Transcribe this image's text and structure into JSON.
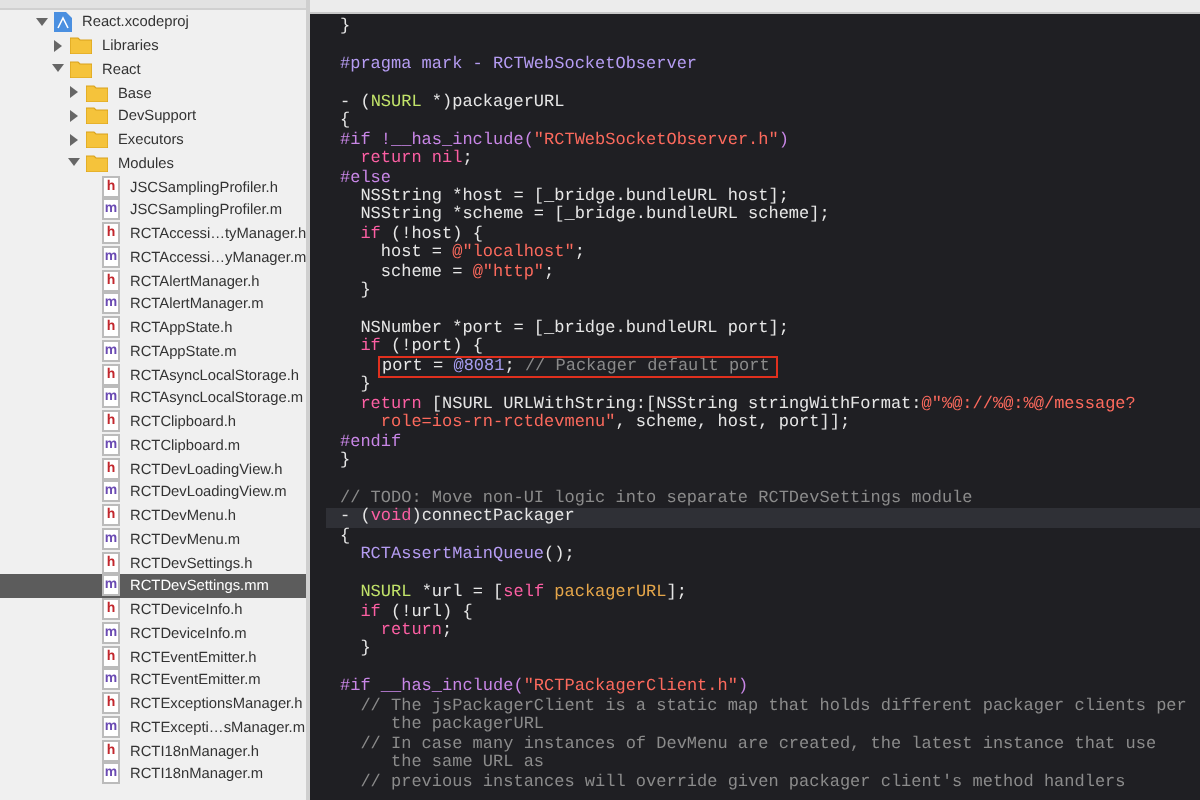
{
  "navigator": {
    "items": [
      {
        "label": "React.xcodeproj",
        "kind": "project",
        "expanded": true,
        "selected": false,
        "children": [
          {
            "label": "Libraries",
            "kind": "folder",
            "expanded": false,
            "selected": false
          },
          {
            "label": "React",
            "kind": "folder",
            "expanded": true,
            "selected": false,
            "children": [
              {
                "label": "Base",
                "kind": "folder",
                "expanded": false,
                "selected": false
              },
              {
                "label": "DevSupport",
                "kind": "folder",
                "expanded": false,
                "selected": false
              },
              {
                "label": "Executors",
                "kind": "folder",
                "expanded": false,
                "selected": false
              },
              {
                "label": "Modules",
                "kind": "folder",
                "expanded": true,
                "selected": false,
                "children": [
                  {
                    "label": "JSCSamplingProfiler.h",
                    "kind": "header",
                    "badge": "h",
                    "selected": false
                  },
                  {
                    "label": "JSCSamplingProfiler.m",
                    "kind": "source",
                    "badge": "m",
                    "selected": false
                  },
                  {
                    "label": "RCTAccessi…tyManager.h",
                    "kind": "header",
                    "badge": "h",
                    "selected": false
                  },
                  {
                    "label": "RCTAccessi…yManager.m",
                    "kind": "source",
                    "badge": "m",
                    "selected": false
                  },
                  {
                    "label": "RCTAlertManager.h",
                    "kind": "header",
                    "badge": "h",
                    "selected": false
                  },
                  {
                    "label": "RCTAlertManager.m",
                    "kind": "source",
                    "badge": "m",
                    "selected": false
                  },
                  {
                    "label": "RCTAppState.h",
                    "kind": "header",
                    "badge": "h",
                    "selected": false
                  },
                  {
                    "label": "RCTAppState.m",
                    "kind": "source",
                    "badge": "m",
                    "selected": false
                  },
                  {
                    "label": "RCTAsyncLocalStorage.h",
                    "kind": "header",
                    "badge": "h",
                    "selected": false
                  },
                  {
                    "label": "RCTAsyncLocalStorage.m",
                    "kind": "source",
                    "badge": "m",
                    "selected": false
                  },
                  {
                    "label": "RCTClipboard.h",
                    "kind": "header",
                    "badge": "h",
                    "selected": false
                  },
                  {
                    "label": "RCTClipboard.m",
                    "kind": "source",
                    "badge": "m",
                    "selected": false
                  },
                  {
                    "label": "RCTDevLoadingView.h",
                    "kind": "header",
                    "badge": "h",
                    "selected": false
                  },
                  {
                    "label": "RCTDevLoadingView.m",
                    "kind": "source",
                    "badge": "m",
                    "selected": false
                  },
                  {
                    "label": "RCTDevMenu.h",
                    "kind": "header",
                    "badge": "h",
                    "selected": false
                  },
                  {
                    "label": "RCTDevMenu.m",
                    "kind": "source",
                    "badge": "m",
                    "selected": false
                  },
                  {
                    "label": "RCTDevSettings.h",
                    "kind": "header",
                    "badge": "h",
                    "selected": false
                  },
                  {
                    "label": "RCTDevSettings.mm",
                    "kind": "source",
                    "badge": "m",
                    "selected": true
                  },
                  {
                    "label": "RCTDeviceInfo.h",
                    "kind": "header",
                    "badge": "h",
                    "selected": false
                  },
                  {
                    "label": "RCTDeviceInfo.m",
                    "kind": "source",
                    "badge": "m",
                    "selected": false
                  },
                  {
                    "label": "RCTEventEmitter.h",
                    "kind": "header",
                    "badge": "h",
                    "selected": false
                  },
                  {
                    "label": "RCTEventEmitter.m",
                    "kind": "source",
                    "badge": "m",
                    "selected": false
                  },
                  {
                    "label": "RCTExceptionsManager.h",
                    "kind": "header",
                    "badge": "h",
                    "selected": false
                  },
                  {
                    "label": "RCTExcepti…sManager.m",
                    "kind": "source",
                    "badge": "m",
                    "selected": false
                  },
                  {
                    "label": "RCTI18nManager.h",
                    "kind": "header",
                    "badge": "h",
                    "selected": false
                  },
                  {
                    "label": "RCTI18nManager.m",
                    "kind": "source",
                    "badge": "m",
                    "selected": false
                  }
                ]
              }
            ]
          }
        ]
      }
    ]
  },
  "editor": {
    "lines": [
      {
        "segs": [
          {
            "kind": "plain",
            "t": "}"
          }
        ]
      },
      {
        "space_before": true,
        "segs": [
          {
            "kind": "mark",
            "t": "#pragma mark - RCTWebSocketObserver"
          }
        ]
      },
      {
        "space_before": true,
        "segs": [
          {
            "kind": "plain",
            "t": "- ("
          },
          {
            "kind": "type",
            "t": "NSURL"
          },
          {
            "kind": "plain",
            "t": " *)packagerURL"
          }
        ]
      },
      {
        "segs": [
          {
            "kind": "plain",
            "t": "{"
          }
        ]
      },
      {
        "segs": [
          {
            "kind": "preproc",
            "t": "#if !__has_include("
          },
          {
            "kind": "string",
            "t": "\"RCTWebSocketObserver.h\""
          },
          {
            "kind": "preproc",
            "t": ")"
          }
        ]
      },
      {
        "segs": [
          {
            "kind": "keyword",
            "t": "  return nil"
          },
          {
            "kind": "plain",
            "t": ";"
          }
        ]
      },
      {
        "segs": [
          {
            "kind": "preproc",
            "t": "#else"
          }
        ]
      },
      {
        "segs": [
          {
            "kind": "plain",
            "t": "  NSString *host = [_bridge.bundleURL host];"
          }
        ]
      },
      {
        "segs": [
          {
            "kind": "plain",
            "t": "  NSString *scheme = [_bridge.bundleURL scheme];"
          }
        ]
      },
      {
        "segs": [
          {
            "kind": "keyword",
            "t": "  if"
          },
          {
            "kind": "plain",
            "t": " (!host) {"
          }
        ]
      },
      {
        "segs": [
          {
            "kind": "plain",
            "t": "    host = "
          },
          {
            "kind": "string",
            "t": "@\"localhost\""
          },
          {
            "kind": "plain",
            "t": ";"
          }
        ]
      },
      {
        "segs": [
          {
            "kind": "plain",
            "t": "    scheme = "
          },
          {
            "kind": "string",
            "t": "@\"http\""
          },
          {
            "kind": "plain",
            "t": ";"
          }
        ]
      },
      {
        "segs": [
          {
            "kind": "plain",
            "t": "  }"
          }
        ]
      },
      {
        "space_before": true,
        "segs": [
          {
            "kind": "plain",
            "t": "  NSNumber *port = [_bridge.bundleURL port];"
          }
        ]
      },
      {
        "segs": [
          {
            "kind": "keyword",
            "t": "  if"
          },
          {
            "kind": "plain",
            "t": " (!port) {"
          }
        ]
      },
      {
        "boxed": true,
        "segs": [
          {
            "kind": "plain",
            "t": "port = "
          },
          {
            "kind": "number",
            "t": "@8081"
          },
          {
            "kind": "plain",
            "t": "; "
          },
          {
            "kind": "comment",
            "t": "// Packager default port"
          }
        ]
      },
      {
        "segs": [
          {
            "kind": "plain",
            "t": "  }"
          }
        ]
      },
      {
        "segs": [
          {
            "kind": "keyword",
            "t": "  return"
          },
          {
            "kind": "plain",
            "t": " [NSURL URLWithString:[NSString stringWithFormat:"
          },
          {
            "kind": "string",
            "t": "@\"%@://%@:%@/message?"
          }
        ]
      },
      {
        "segs": [
          {
            "kind": "string",
            "t": "    role=ios-rn-rctdevmenu\""
          },
          {
            "kind": "plain",
            "t": ", scheme, host, port]];"
          }
        ]
      },
      {
        "segs": [
          {
            "kind": "preproc",
            "t": "#endif"
          }
        ]
      },
      {
        "segs": [
          {
            "kind": "plain",
            "t": "}"
          }
        ]
      },
      {
        "space_before": true,
        "segs": [
          {
            "kind": "comment",
            "t": "// TODO: Move non-UI logic into separate RCTDevSettings module"
          }
        ]
      },
      {
        "current": true,
        "segs": [
          {
            "kind": "plain",
            "t": "- ("
          },
          {
            "kind": "keyword",
            "t": "void"
          },
          {
            "kind": "plain",
            "t": ")connectPackager"
          }
        ]
      },
      {
        "segs": [
          {
            "kind": "plain",
            "t": "{"
          }
        ]
      },
      {
        "segs": [
          {
            "kind": "mark",
            "t": "  RCTAssertMainQueue"
          },
          {
            "kind": "plain",
            "t": "();"
          }
        ]
      },
      {
        "space_before": true,
        "segs": [
          {
            "kind": "type",
            "t": "  NSURL"
          },
          {
            "kind": "plain",
            "t": " *url = ["
          },
          {
            "kind": "keyword",
            "t": "self"
          },
          {
            "kind": "method",
            "t": " packagerURL"
          },
          {
            "kind": "plain",
            "t": "];"
          }
        ]
      },
      {
        "segs": [
          {
            "kind": "keyword",
            "t": "  if"
          },
          {
            "kind": "plain",
            "t": " (!url) {"
          }
        ]
      },
      {
        "segs": [
          {
            "kind": "keyword",
            "t": "    return"
          },
          {
            "kind": "plain",
            "t": ";"
          }
        ]
      },
      {
        "segs": [
          {
            "kind": "plain",
            "t": "  }"
          }
        ]
      },
      {
        "space_before": true,
        "segs": [
          {
            "kind": "preproc",
            "t": "#if __has_include("
          },
          {
            "kind": "string",
            "t": "\"RCTPackagerClient.h\""
          },
          {
            "kind": "preproc",
            "t": ")"
          }
        ]
      },
      {
        "segs": [
          {
            "kind": "comment",
            "t": "  // The jsPackagerClient is a static map that holds different packager clients per"
          }
        ]
      },
      {
        "segs": [
          {
            "kind": "comment",
            "t": "     the packagerURL"
          }
        ]
      },
      {
        "segs": [
          {
            "kind": "comment",
            "t": "  // In case many instances of DevMenu are created, the latest instance that use"
          }
        ]
      },
      {
        "segs": [
          {
            "kind": "comment",
            "t": "     the same URL as"
          }
        ]
      },
      {
        "segs": [
          {
            "kind": "comment",
            "t": "  // previous instances will override given packager client's method handlers"
          }
        ]
      }
    ]
  }
}
